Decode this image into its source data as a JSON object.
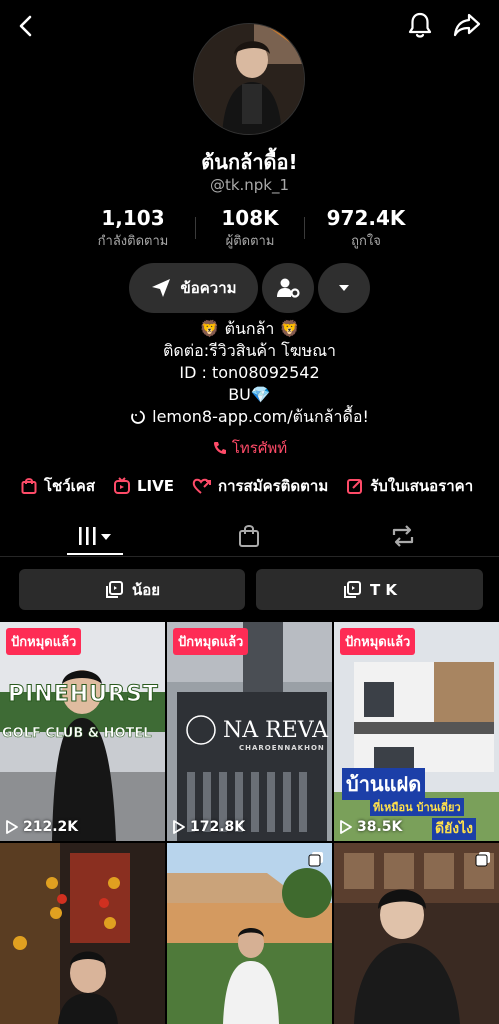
{
  "profile": {
    "display_name": "ต้นกล้าดื้อ!",
    "username": "@tk.npk_1"
  },
  "stats": [
    {
      "value": "1,103",
      "label": "กำลังติดตาม"
    },
    {
      "value": "108K",
      "label": "ผู้ติดตาม"
    },
    {
      "value": "972.4K",
      "label": "ถูกใจ"
    }
  ],
  "actions": {
    "message_label": "ข้อความ"
  },
  "bio": {
    "line1": "🦁 ต้นกล้า 🦁",
    "line2": "ติดต่อ:รีวิวสินค้า โฆษณา",
    "line3": "ID : ton08092542",
    "line4": "BU💎",
    "link": "lemon8-app.com/ต้นกล้าดื้อ!",
    "phone_label": "โทรศัพท์"
  },
  "features": [
    {
      "label": "โชว์เคส",
      "icon": "shopping-bag-icon"
    },
    {
      "label": "LIVE",
      "icon": "tv-icon"
    },
    {
      "label": "การสมัครติดตาม",
      "icon": "heart-arrow-icon"
    },
    {
      "label": "รับใบเสนอราคา",
      "icon": "edit-note-icon"
    }
  ],
  "filters": [
    {
      "label": "น้อย",
      "icon": "playlist-icon"
    },
    {
      "label": "T K",
      "icon": "playlist-icon"
    }
  ],
  "videos": [
    {
      "pinned": "ปักหมุดแล้ว",
      "views": "212.2K",
      "overlay": [
        "PINEHURST",
        "GOLF CLUB & HOTEL"
      ]
    },
    {
      "pinned": "ปักหมุดแล้ว",
      "views": "172.8K",
      "overlay": [
        "NA REVA",
        "CHAROENNAKHON"
      ]
    },
    {
      "pinned": "ปักหมุดแล้ว",
      "views": "38.5K",
      "overlay": [
        "บ้านแฝด",
        "ที่เหมือน บ้านเดี่ยว",
        "ดียังไง"
      ]
    },
    {
      "pinned": "",
      "views": "",
      "overlay": []
    },
    {
      "pinned": "",
      "views": "",
      "overlay": []
    },
    {
      "pinned": "",
      "views": "",
      "overlay": []
    }
  ],
  "colors": {
    "accent": "#fe2c55",
    "phone": "#fe4b68",
    "button_bg": "#2f2f2f"
  }
}
